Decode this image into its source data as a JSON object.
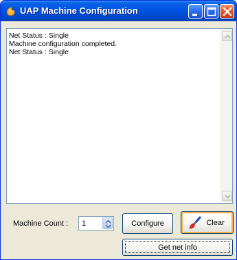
{
  "window": {
    "title": "UAP Machine Configuration",
    "icon": "app-icon",
    "controls": [
      "minimize-icon",
      "maximize-icon",
      "close-icon"
    ]
  },
  "log": {
    "lines": [
      "Net Status : Single",
      "Machine configuration completed.",
      "Net Status : Single"
    ]
  },
  "controls": {
    "machine_count_label": "Machine Count :",
    "machine_count_value": "1",
    "configure_label": "Configure",
    "clear_label": "Clear",
    "get_net_info_label": "Get net info"
  },
  "colors": {
    "titlebar": "#0054e3",
    "close_button": "#e05a2a",
    "window_bg": "#ece9d8",
    "default_button_highlight": "#f8b348"
  }
}
